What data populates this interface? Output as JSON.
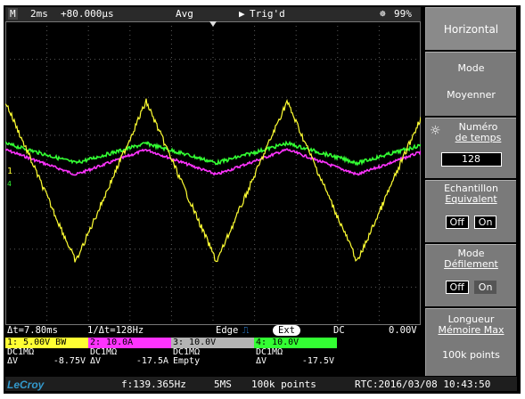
{
  "top_bar": {
    "mode_icon": "M",
    "timebase": "2ms",
    "trigger_delay": "+80.000µs",
    "acq_mode": "Avg",
    "trigger_status": "Trig'd",
    "battery": "99%"
  },
  "cursor_row": {
    "delta_t": "Δt=7.80ms",
    "inv_delta_t": "1/Δt=128Hz",
    "trigger_type": "Edge",
    "trigger_source": "Ext",
    "coupling": "DC",
    "trigger_level": "0.00V"
  },
  "channels": [
    {
      "header": "1: 5.00V  BW",
      "color": "#ffff33",
      "coupling": "DC1MΩ",
      "dv_label": "ΔV",
      "dv_value": "-8.75V"
    },
    {
      "header": "2: 10.0A",
      "color": "#ff33ff",
      "coupling": "DC1MΩ",
      "dv_label": "ΔV",
      "dv_value": "-17.5A"
    },
    {
      "header": "3: 10.0V",
      "color": "#b4b4b4",
      "coupling": "DC1MΩ",
      "dv_label": "Empty",
      "dv_value": ""
    },
    {
      "header": "4: 10.0V",
      "color": "#33ff33",
      "coupling": "DC1MΩ",
      "dv_label": "ΔV",
      "dv_value": "-17.5V"
    }
  ],
  "bottom_bar": {
    "brand": "LeCroy",
    "frequency": "f:139.365Hz",
    "sample_rate": "5MS",
    "record": "100k points",
    "rtc": "RTC:2016/03/08 10:43:50"
  },
  "panel": {
    "title": "Horizontal",
    "mode_label": "Mode",
    "mode_value": "Moyenner",
    "numero_label_1": "Numéro",
    "numero_label_2": "de temps",
    "numero_value": "128",
    "echant_label_1": "Echantillon",
    "echant_label_2": "Equivalent",
    "echant_off": "Off",
    "echant_on": "On",
    "defil_label_1": "Mode",
    "defil_label_2": "Défilement",
    "defil_off": "Off",
    "defil_on": "On",
    "longueur_label_1": "Longueur",
    "longueur_label_2": "Mémoire Max",
    "longueur_value": "100k points"
  },
  "colors": {
    "ch1": "#ffff33",
    "ch2": "#ff33ff",
    "ch4": "#33ff33",
    "grid": "#5a5a5a",
    "cursor_marker": "#ffff33"
  },
  "channel_markers": {
    "ch1": "1",
    "ch4": "4"
  }
}
